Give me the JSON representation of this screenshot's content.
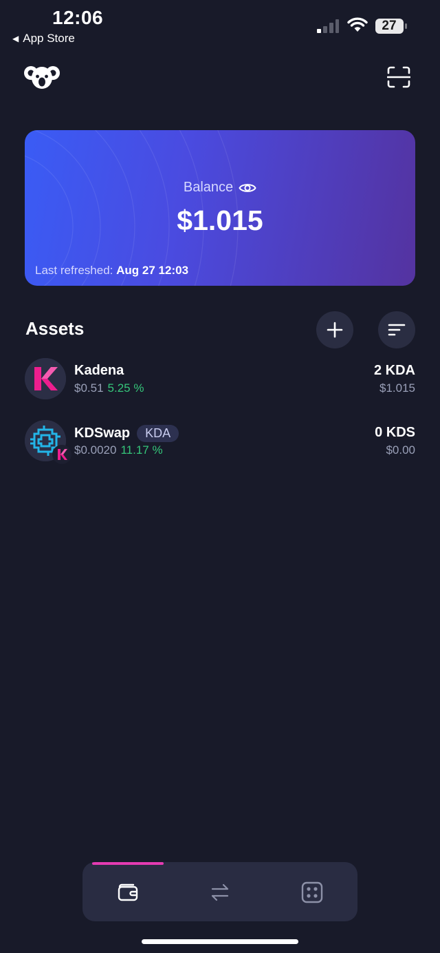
{
  "status_bar": {
    "time": "12:06",
    "back_label": "App Store",
    "battery_level": "27"
  },
  "header": {
    "logo_icon": "koala-icon",
    "scan_icon": "qr-scan-icon"
  },
  "balance_card": {
    "label": "Balance",
    "value": "$1.015",
    "refreshed_label": "Last refreshed:",
    "refreshed_time": "Aug 27 12:03"
  },
  "assets": {
    "title": "Assets",
    "add_icon": "plus-icon",
    "sort_icon": "sort-icon",
    "items": [
      {
        "name": "Kadena",
        "price": "$0.51",
        "change": "5.25 %",
        "amount": "2 KDA",
        "fiat": "$1.015"
      },
      {
        "name": "KDSwap",
        "chip": "KDA",
        "price": "$0.0020",
        "change": "11.17 %",
        "amount": "0 KDS",
        "fiat": "$0.00"
      }
    ]
  },
  "bottom_nav": {
    "items": [
      {
        "icon": "wallet-icon",
        "active": true
      },
      {
        "icon": "swap-arrows-icon",
        "active": false
      },
      {
        "icon": "apps-icon",
        "active": false
      }
    ]
  },
  "colors": {
    "background": "#181a29",
    "accent_pink": "#e43bb2",
    "positive_green": "#35c67a",
    "card_gradient_start": "#3a5cf5",
    "card_gradient_end": "#5433a0"
  }
}
